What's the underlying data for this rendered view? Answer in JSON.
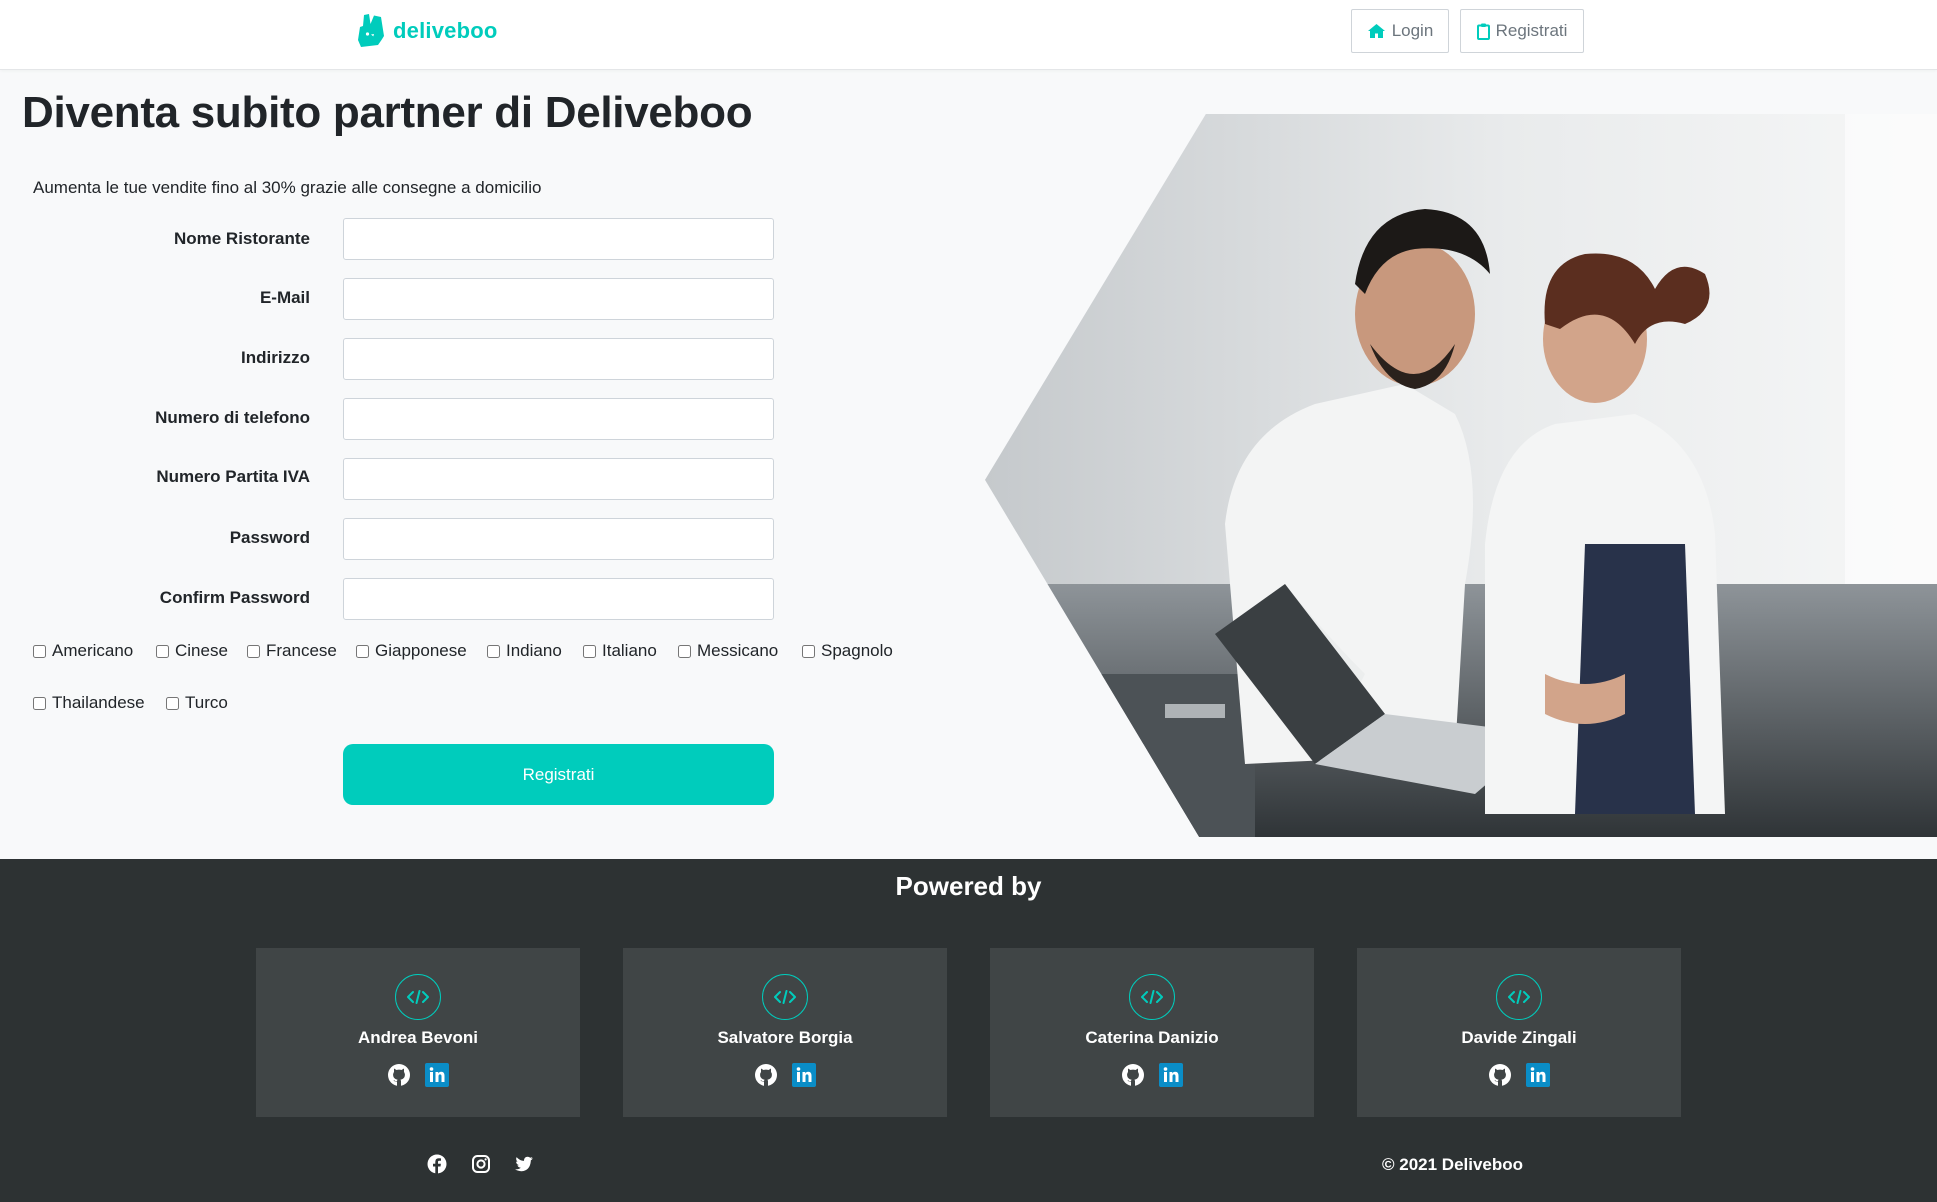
{
  "colors": {
    "accent": "#00ccbc",
    "footer_bg": "#2d3233",
    "card_bg": "#404546",
    "linkedin": "#0a8dc7"
  },
  "header": {
    "brand": "deliveboo",
    "nav": {
      "login": {
        "icon": "home-icon",
        "label": "Login"
      },
      "register": {
        "icon": "clipboard-icon",
        "label": "Registrati"
      }
    }
  },
  "main": {
    "title": "Diventa subito partner di Deliveboo",
    "subtitle": "Aumenta le tue vendite fino al 30% grazie alle consegne a domicilio",
    "form": {
      "fields": [
        {
          "label": "Nome Ristorante",
          "value": "",
          "placeholder": ""
        },
        {
          "label": "E-Mail",
          "value": "",
          "placeholder": ""
        },
        {
          "label": "Indirizzo",
          "value": "",
          "placeholder": ""
        },
        {
          "label": "Numero di telefono",
          "value": "",
          "placeholder": ""
        },
        {
          "label": "Numero Partita IVA",
          "value": "",
          "placeholder": ""
        },
        {
          "label": "Password",
          "value": "",
          "placeholder": ""
        },
        {
          "label": "Confirm Password",
          "value": "",
          "placeholder": ""
        }
      ],
      "categories": [
        {
          "label": "Americano",
          "checked": false
        },
        {
          "label": "Cinese",
          "checked": false
        },
        {
          "label": "Francese",
          "checked": false
        },
        {
          "label": "Giapponese",
          "checked": false
        },
        {
          "label": "Indiano",
          "checked": false
        },
        {
          "label": "Italiano",
          "checked": false
        },
        {
          "label": "Messicano",
          "checked": false
        },
        {
          "label": "Spagnolo",
          "checked": false
        },
        {
          "label": "Thailandese",
          "checked": false
        },
        {
          "label": "Turco",
          "checked": false
        }
      ],
      "submit_label": "Registrati"
    },
    "hero_image": "chefs-with-laptop-photo"
  },
  "footer": {
    "heading": "Powered by",
    "team": [
      {
        "name": "Andrea Bevoni",
        "icon": "code-icon",
        "links": [
          "github-icon",
          "linkedin-icon"
        ]
      },
      {
        "name": "Salvatore Borgia",
        "icon": "code-icon",
        "links": [
          "github-icon",
          "linkedin-icon"
        ]
      },
      {
        "name": "Caterina Danizio",
        "icon": "code-icon",
        "links": [
          "github-icon",
          "linkedin-icon"
        ]
      },
      {
        "name": "Davide Zingali",
        "icon": "code-icon",
        "links": [
          "github-icon",
          "linkedin-icon"
        ]
      }
    ],
    "social": [
      "facebook-icon",
      "instagram-icon",
      "twitter-icon"
    ],
    "copyright": "© 2021 Deliveboo"
  }
}
